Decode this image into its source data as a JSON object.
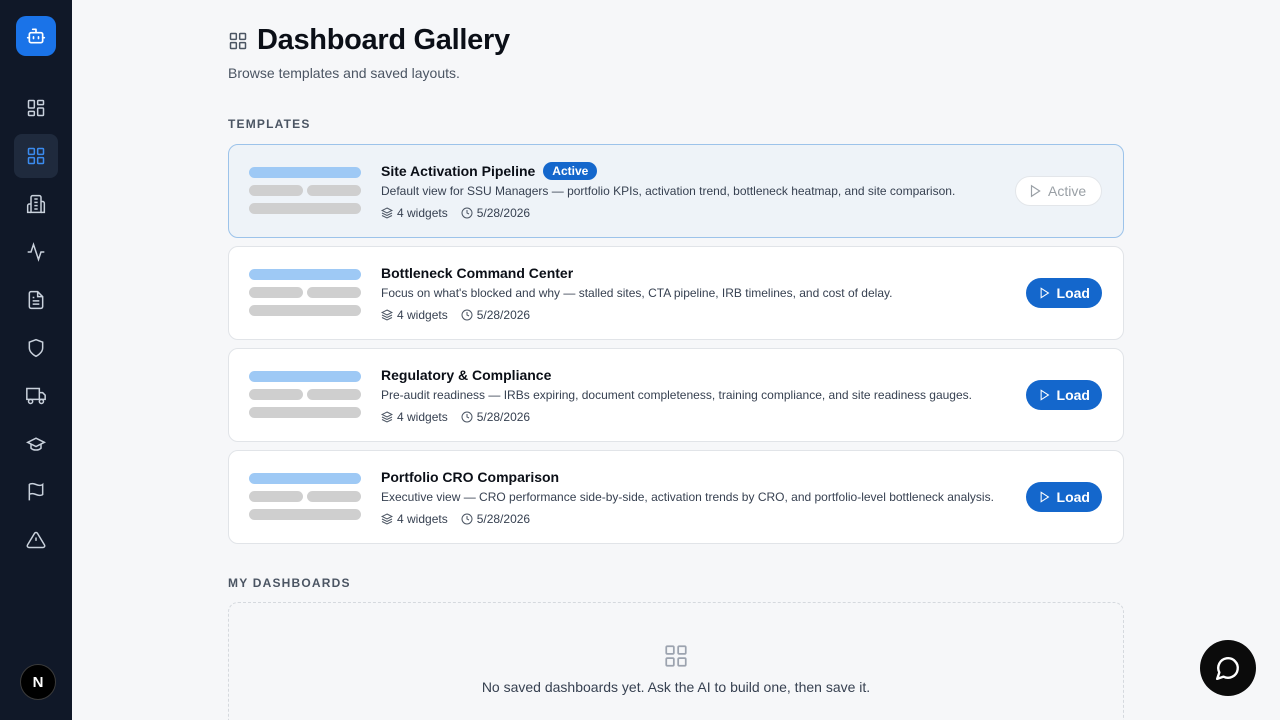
{
  "sidebar": {
    "items": [
      {
        "icon": "dashboard-icon"
      },
      {
        "icon": "gallery-grid-icon",
        "active": true
      },
      {
        "icon": "building-icon"
      },
      {
        "icon": "activity-icon"
      },
      {
        "icon": "document-icon"
      },
      {
        "icon": "shield-icon"
      },
      {
        "icon": "truck-icon"
      },
      {
        "icon": "graduation-cap-icon"
      },
      {
        "icon": "flag-icon"
      },
      {
        "icon": "alert-triangle-icon"
      }
    ],
    "avatar_initial": "N"
  },
  "header": {
    "title": "Dashboard Gallery",
    "subtitle": "Browse templates and saved layouts."
  },
  "templates": {
    "section_label": "TEMPLATES",
    "items": [
      {
        "name": "Site Activation Pipeline",
        "badge": "Active",
        "description": "Default view for SSU Managers — portfolio KPIs, activation trend, bottleneck heatmap, and site comparison.",
        "widgets": "4 widgets",
        "date": "5/28/2026",
        "action": "Active"
      },
      {
        "name": "Bottleneck Command Center",
        "description": "Focus on what's blocked and why — stalled sites, CTA pipeline, IRB timelines, and cost of delay.",
        "widgets": "4 widgets",
        "date": "5/28/2026",
        "action": "Load"
      },
      {
        "name": "Regulatory & Compliance",
        "description": "Pre-audit readiness — IRBs expiring, document completeness, training compliance, and site readiness gauges.",
        "widgets": "4 widgets",
        "date": "5/28/2026",
        "action": "Load"
      },
      {
        "name": "Portfolio CRO Comparison",
        "description": "Executive view — CRO performance side-by-side, activation trends by CRO, and portfolio-level bottleneck analysis.",
        "widgets": "4 widgets",
        "date": "5/28/2026",
        "action": "Load"
      }
    ]
  },
  "my_dashboards": {
    "section_label": "MY DASHBOARDS",
    "empty_text": "No saved dashboards yet. Ask the AI to build one, then save it."
  },
  "colors": {
    "sidebar_bg": "#101828",
    "accent": "#1467cc",
    "active_card_bg": "#eef3f8"
  }
}
